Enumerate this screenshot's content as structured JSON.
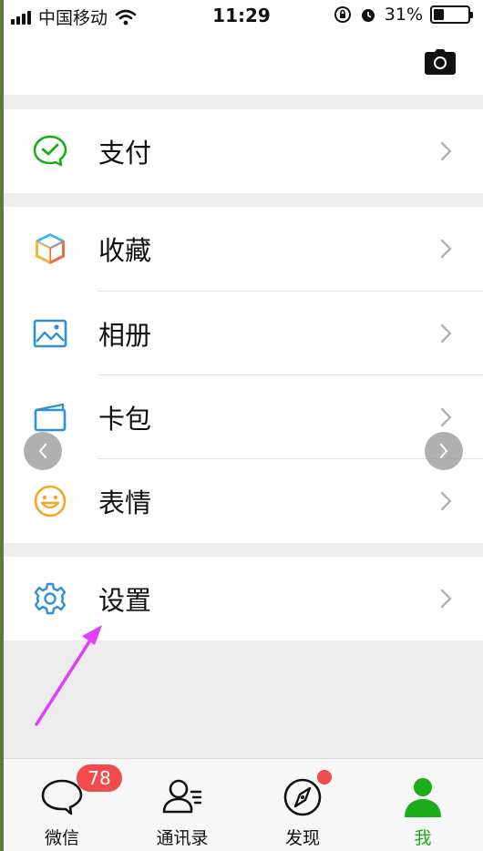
{
  "status_bar": {
    "carrier": "中国移动",
    "time": "11:29",
    "battery": "31%",
    "battery_level": 0.31
  },
  "menu": {
    "pay": "支付",
    "favorites": "收藏",
    "album": "相册",
    "cards": "卡包",
    "stickers": "表情",
    "settings": "设置"
  },
  "tabbar": {
    "chats": "微信",
    "chats_badge": "78",
    "contacts": "通讯录",
    "discover": "发现",
    "me": "我"
  },
  "colors": {
    "wechat_green": "#1aad19",
    "badge_red": "#f24b4b",
    "annotation_magenta": "#e040fb"
  }
}
